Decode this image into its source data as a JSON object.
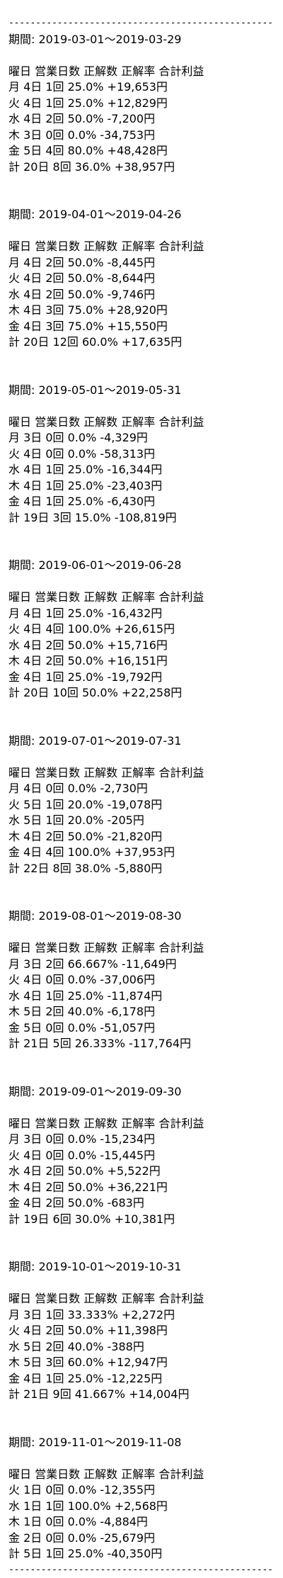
{
  "separator": "------------------------------------------------------------------------",
  "header_label": "曜日 営業日数 正解数 正解率 合計利益",
  "periods": [
    {
      "period": "期間: 2019-03-01～2019-03-29",
      "rows": [
        "月 4日 1回 25.0% +19,653円",
        "火 4日 1回 25.0% +12,829円",
        "水 4日 2回 50.0% -7,200円",
        "木 3日 0回 0.0% -34,753円",
        "金 5日 4回 80.0% +48,428円",
        "計 20日 8回 36.0% +38,957円"
      ]
    },
    {
      "period": "期間: 2019-04-01～2019-04-26",
      "rows": [
        "月 4日 2回 50.0% -8,445円",
        "火 4日 2回 50.0% -8,644円",
        "水 4日 2回 50.0% -9,746円",
        "木 4日 3回 75.0% +28,920円",
        "金 4日 3回 75.0% +15,550円",
        "計 20日 12回 60.0% +17,635円"
      ]
    },
    {
      "period": "期間: 2019-05-01～2019-05-31",
      "rows": [
        "月 3日 0回 0.0% -4,329円",
        "火 4日 0回 0.0% -58,313円",
        "水 4日 1回 25.0% -16,344円",
        "木 4日 1回 25.0% -23,403円",
        "金 4日 1回 25.0% -6,430円",
        "計 19日 3回 15.0% -108,819円"
      ]
    },
    {
      "period": "期間: 2019-06-01～2019-06-28",
      "rows": [
        "月 4日 1回 25.0% -16,432円",
        "火 4日 4回 100.0% +26,615円",
        "水 4日 2回 50.0% +15,716円",
        "木 4日 2回 50.0% +16,151円",
        "金 4日 1回 25.0% -19,792円",
        "計 20日 10回 50.0% +22,258円"
      ]
    },
    {
      "period": "期間: 2019-07-01～2019-07-31",
      "rows": [
        "月 4日 0回 0.0% -2,730円",
        "火 5日 1回 20.0% -19,078円",
        "水 5日 1回 20.0% -205円",
        "木 4日 2回 50.0% -21,820円",
        "金 4日 4回 100.0% +37,953円",
        "計 22日 8回 38.0% -5,880円"
      ]
    },
    {
      "period": "期間: 2019-08-01～2019-08-30",
      "rows": [
        "月 3日 2回 66.667% -11,649円",
        "火 4日 0回 0.0% -37,006円",
        "水 4日 1回 25.0% -11,874円",
        "木 5日 2回 40.0% -6,178円",
        "金 5日 0回 0.0% -51,057円",
        "計 21日 5回 26.333% -117,764円"
      ]
    },
    {
      "period": "期間: 2019-09-01～2019-09-30",
      "rows": [
        "月 3日 0回 0.0% -15,234円",
        "火 4日 0回 0.0% -15,445円",
        "水 4日 2回 50.0% +5,522円",
        "木 4日 2回 50.0% +36,221円",
        "金 4日 2回 50.0% -683円",
        "計 19日 6回 30.0% +10,381円"
      ]
    },
    {
      "period": "期間: 2019-10-01～2019-10-31",
      "rows": [
        "月 3日 1回 33.333% +2,272円",
        "火 4日 2回 50.0% +11,398円",
        "水 5日 2回 40.0% -388円",
        "木 5日 3回 60.0% +12,947円",
        "金 4日 1回 25.0% -12,225円",
        "計 21日 9回 41.667% +14,004円"
      ]
    },
    {
      "period": "期間: 2019-11-01～2019-11-08",
      "rows": [
        "火 1日 0回 0.0% -12,355円",
        "水 1日 1回 100.0% +2,568円",
        "木 1日 0回 0.0% -4,884円",
        "金 2日 0回 0.0% -25,679円",
        "計 5日 1回 25.0% -40,350円"
      ]
    }
  ]
}
